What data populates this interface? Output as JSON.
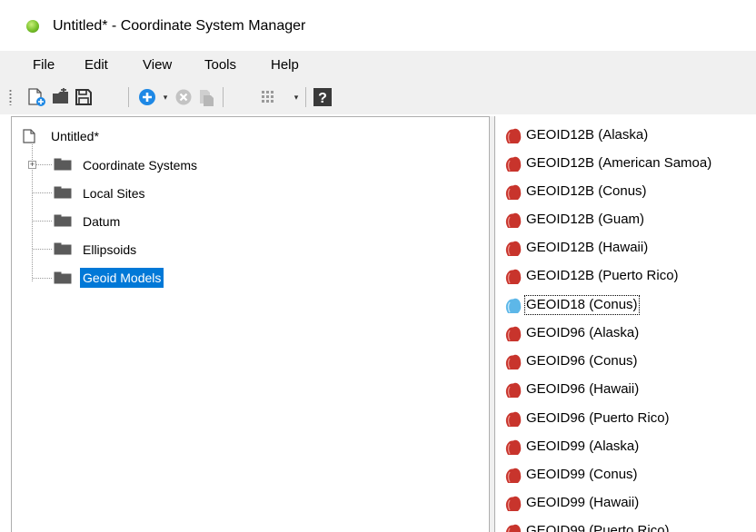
{
  "window": {
    "title": "Untitled* - Coordinate System Manager",
    "app_icon": "globe-icon"
  },
  "menu": [
    "File",
    "Edit",
    "View",
    "Tools",
    "Help"
  ],
  "toolbar": {
    "buttons": [
      "new-document-icon",
      "open-folder-icon",
      "save-icon",
      "add-icon",
      "delete-icon",
      "copy-icon",
      "list-view-icon",
      "help-icon"
    ]
  },
  "tree": {
    "root": "Untitled*",
    "items": [
      "Coordinate Systems",
      "Local Sites",
      "Datum",
      "Ellipsoids",
      "Geoid Models"
    ],
    "selected": "Geoid Models"
  },
  "list": {
    "items": [
      "GEOID12B (Alaska)",
      "GEOID12B (American Samoa)",
      "GEOID12B (Conus)",
      "GEOID12B (Guam)",
      "GEOID12B (Hawaii)",
      "GEOID12B (Puerto Rico)",
      "GEOID18 (Conus)",
      "GEOID96 (Alaska)",
      "GEOID96 (Conus)",
      "GEOID96 (Hawaii)",
      "GEOID96 (Puerto Rico)",
      "GEOID99 (Alaska)",
      "GEOID99 (Conus)",
      "GEOID99 (Hawaii)",
      "GEOID99 (Puerto Rico)"
    ],
    "focused": "GEOID18 (Conus)",
    "colors": {
      "geoid_icon": "#c8342c",
      "geoid_icon_focused": "#5db7e8"
    }
  },
  "colors": {
    "selection": "#0078d7",
    "chrome": "#f0f0f0"
  }
}
